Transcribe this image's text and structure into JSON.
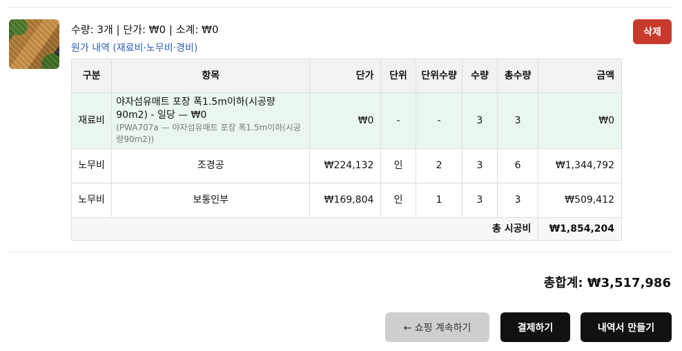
{
  "cart_item": {
    "thumbnail_alt": "야자섬유매트 포장",
    "summary": "수량: 3개 | 단가: ₩0 | 소계: ₩0",
    "cost_link": "원가 내역 (재료비·노무비·경비)",
    "delete_label": "삭제"
  },
  "cost_table": {
    "headers": [
      "구분",
      "항목",
      "단가",
      "단위",
      "단위수량",
      "수량",
      "총수량",
      "금액"
    ],
    "rows": [
      {
        "category": "재료비",
        "item": "야자섬유매트 포장 폭1.5m이하(시공량90m2) - 일당 — ₩0",
        "item_sub": "(PWA707a — 야자섬유매트 포장 폭1.5m이하(시공량90m2))",
        "unit_price": "₩0",
        "unit": "-",
        "unit_qty": "-",
        "qty": "3",
        "total_qty": "3",
        "amount": "₩0"
      },
      {
        "category": "노무비",
        "item": "조경공",
        "unit_price": "₩224,132",
        "unit": "인",
        "unit_qty": "2",
        "qty": "3",
        "total_qty": "6",
        "amount": "₩1,344,792"
      },
      {
        "category": "노무비",
        "item": "보통인부",
        "unit_price": "₩169,804",
        "unit": "인",
        "unit_qty": "1",
        "qty": "3",
        "total_qty": "3",
        "amount": "₩509,412"
      }
    ],
    "total_label": "총 시공비",
    "total_value": "₩1,854,204"
  },
  "grand_total": "총합계: ₩3,517,986",
  "actions": {
    "continue_label": "← 쇼핑 계속하기",
    "pay_label": "결제하기",
    "quote_label": "내역서 만들기"
  },
  "colors": {
    "delete": "#c83a2c",
    "material_row": "#eaf7ee",
    "link": "#2b5fb8",
    "primary_button": "#111111",
    "secondary_button": "#cfcfcf"
  }
}
